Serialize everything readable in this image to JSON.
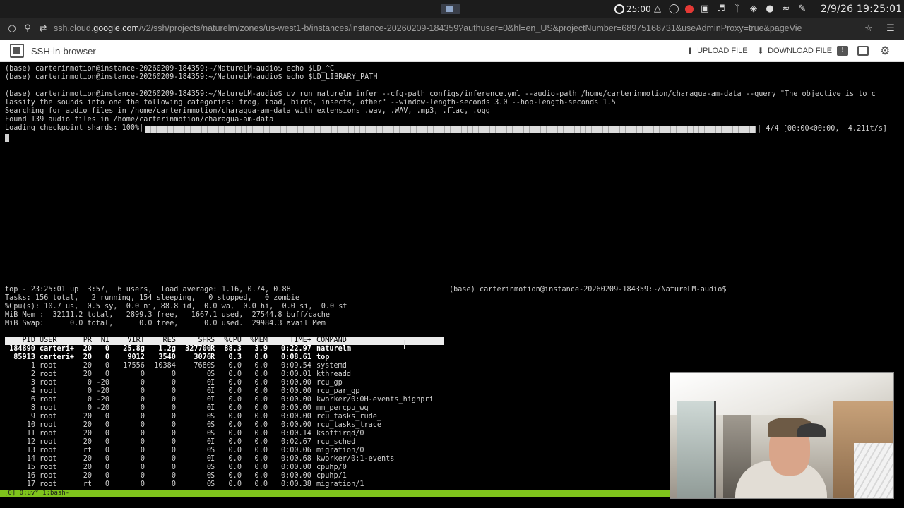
{
  "system_bar": {
    "timer": "25:00",
    "datetime": "2/9/26 19:25:01",
    "icons": [
      "timer-icon",
      "bell-icon",
      "do-not-disturb-icon",
      "record-icon",
      "clipboard-icon",
      "volume-icon",
      "bluetooth-icon",
      "vpn-icon",
      "microphone-icon",
      "wifi-icon",
      "notes-icon"
    ],
    "record_color": "#e53935"
  },
  "browser": {
    "url_host": "ssh.cloud.",
    "url_domain": "google.com",
    "url_path": "/v2/ssh/projects/naturelm/zones/us-west1-b/instances/instance-20260209-184359?authuser=0&hl=en_US&projectNumber=68975168731&useAdminProxy=true&pageVie"
  },
  "ssh_header": {
    "title": "SSH-in-browser",
    "upload_label": "UPLOAD FILE",
    "download_label": "DOWNLOAD FILE"
  },
  "terminal": {
    "lines": [
      "(base) carterinmotion@instance-20260209-184359:~/NatureLM-audio$ echo $LD_^C",
      "(base) carterinmotion@instance-20260209-184359:~/NatureLM-audio$ echo $LD_LIBRARY_PATH",
      "",
      "(base) carterinmotion@instance-20260209-184359:~/NatureLM-audio$ uv run naturelm infer --cfg-path configs/inference.yml --audio-path /home/carterinmotion/charagua-am-data --query \"The objective is to c",
      "lassify the sounds into one the following categories: frog, toad, birds, insects, other\" --window-length-seconds 3.0 --hop-length-seconds 1.5",
      "Searching for audio files in /home/carterinmotion/charagua-am-data with extensions .wav, .WAV, .mp3, .flac, .ogg",
      "Found 139 audio files in /home/carterinmotion/charagua-am-data"
    ],
    "progress_prefix": "Loading checkpoint shards: 100%|",
    "progress_fraction": 1.0,
    "progress_suffix": "| 4/4 [00:00<00:00,  4.21it/s]"
  },
  "top": {
    "summary": [
      "top - 23:25:01 up  3:57,  6 users,  load average: 1.16, 0.74, 0.88",
      "Tasks: 156 total,   2 running, 154 sleeping,   0 stopped,   0 zombie",
      "%Cpu(s): 10.7 us,  0.5 sy,  0.0 ni, 88.8 id,  0.0 wa,  0.0 hi,  0.0 si,  0.0 st",
      "MiB Mem :  32111.2 total,   2899.3 free,   1667.1 used,  27544.8 buff/cache",
      "MiB Swap:      0.0 total,      0.0 free,      0.0 used.  29984.3 avail Mem"
    ],
    "columns": [
      "PID",
      "USER",
      "PR",
      "NI",
      "VIRT",
      "RES",
      "SHR",
      "S",
      "%CPU",
      "%MEM",
      "TIME+",
      "COMMAND"
    ],
    "processes": [
      [
        "184890",
        "carteri+",
        "20",
        "0",
        "25.8g",
        "1.2g",
        "327700",
        "R",
        "88.3",
        "3.9",
        "0:22.97",
        "naturelm"
      ],
      [
        "85913",
        "carteri+",
        "20",
        "0",
        "9012",
        "3540",
        "3076",
        "R",
        "0.3",
        "0.0",
        "0:08.61",
        "top"
      ],
      [
        "1",
        "root",
        "20",
        "0",
        "17556",
        "10384",
        "7680",
        "S",
        "0.0",
        "0.0",
        "0:09.54",
        "systemd"
      ],
      [
        "2",
        "root",
        "20",
        "0",
        "0",
        "0",
        "0",
        "S",
        "0.0",
        "0.0",
        "0:00.01",
        "kthreadd"
      ],
      [
        "3",
        "root",
        "0",
        "-20",
        "0",
        "0",
        "0",
        "I",
        "0.0",
        "0.0",
        "0:00.00",
        "rcu_gp"
      ],
      [
        "4",
        "root",
        "0",
        "-20",
        "0",
        "0",
        "0",
        "I",
        "0.0",
        "0.0",
        "0:00.00",
        "rcu_par_gp"
      ],
      [
        "6",
        "root",
        "0",
        "-20",
        "0",
        "0",
        "0",
        "I",
        "0.0",
        "0.0",
        "0:00.00",
        "kworker/0:0H-events_highpri"
      ],
      [
        "8",
        "root",
        "0",
        "-20",
        "0",
        "0",
        "0",
        "I",
        "0.0",
        "0.0",
        "0:00.00",
        "mm_percpu_wq"
      ],
      [
        "9",
        "root",
        "20",
        "0",
        "0",
        "0",
        "0",
        "S",
        "0.0",
        "0.0",
        "0:00.00",
        "rcu_tasks_rude_"
      ],
      [
        "10",
        "root",
        "20",
        "0",
        "0",
        "0",
        "0",
        "S",
        "0.0",
        "0.0",
        "0:00.00",
        "rcu_tasks_trace"
      ],
      [
        "11",
        "root",
        "20",
        "0",
        "0",
        "0",
        "0",
        "S",
        "0.0",
        "0.0",
        "0:00.14",
        "ksoftirqd/0"
      ],
      [
        "12",
        "root",
        "20",
        "0",
        "0",
        "0",
        "0",
        "I",
        "0.0",
        "0.0",
        "0:02.67",
        "rcu_sched"
      ],
      [
        "13",
        "root",
        "rt",
        "0",
        "0",
        "0",
        "0",
        "S",
        "0.0",
        "0.0",
        "0:00.06",
        "migration/0"
      ],
      [
        "14",
        "root",
        "20",
        "0",
        "0",
        "0",
        "0",
        "I",
        "0.0",
        "0.0",
        "0:00.68",
        "kworker/0:1-events"
      ],
      [
        "15",
        "root",
        "20",
        "0",
        "0",
        "0",
        "0",
        "S",
        "0.0",
        "0.0",
        "0:00.00",
        "cpuhp/0"
      ],
      [
        "16",
        "root",
        "20",
        "0",
        "0",
        "0",
        "0",
        "S",
        "0.0",
        "0.0",
        "0:00.00",
        "cpuhp/1"
      ],
      [
        "17",
        "root",
        "rt",
        "0",
        "0",
        "0",
        "0",
        "S",
        "0.0",
        "0.0",
        "0:00.38",
        "migration/1"
      ]
    ]
  },
  "right_pane": {
    "prompt": "(base) carterinmotion@instance-20260209-184359:~/NatureLM-audio$"
  },
  "tmux": {
    "status": "[0] 0:uv* 1:bash-",
    "color": "#7fc41c"
  },
  "webcam": {
    "label": "webcam-feed"
  }
}
